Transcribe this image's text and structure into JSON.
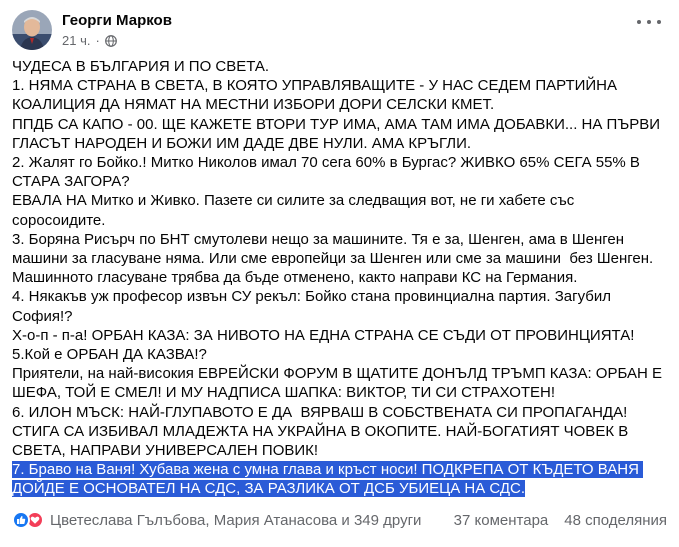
{
  "post": {
    "author": "Георги Марков",
    "time": "21 ч.",
    "dot": "·",
    "paragraphs": [
      "ЧУДЕСА В БЪЛГАРИЯ И ПО СВЕТА.",
      "1. НЯМА СТРАНА В СВЕТА, В КОЯТО УПРАВЛЯВАЩИТЕ - У НАС СЕДЕМ ПАРТИЙНА КОАЛИЦИЯ ДА НЯМАТ НА МЕСТНИ ИЗБОРИ ДОРИ СЕЛСКИ КМЕТ.",
      "ППДБ СА КАПО - 00. ЩЕ КАЖЕТЕ ВТОРИ ТУР ИМА, АМА ТАМ ИМА ДОБАВКИ... НА ПЪРВИ ГЛАСЪТ НАРОДЕН И БОЖИ ИМ ДАДЕ ДВЕ НУЛИ. АМА КРЪГЛИ.",
      "2. Жалят го Бойко.! Митко Николов имал 70 сега 60% в Бургас? ЖИВКО 65% СЕГА 55% В СТАРА ЗАГОРА?",
      "ЕВАЛА НА Митко и Живко. Пазете си силите за следващия вот, не ги хабете със соросоидите.",
      "3. Боряна Рисърч по БНТ смутолеви нещо за машините. Тя е за, Шенген, ама в Шенген машини за гласуване няма. Или сме европейци за Шенген или сме за машини  без Шенген. Машинното гласуване трябва да бъде отменено, както направи КС на Германия.",
      "4. Някакъв уж професор извън СУ рекъл: Бойко стана провинциална партия. Загубил София!?",
      "Х-о-п - п-а! ОРБАН КАЗА: ЗА НИВОТО НА ЕДНА СТРАНА СЕ СЪДИ ОТ ПРОВИНЦИЯТА!",
      "5.Кой е ОРБАН ДА КАЗВА!?",
      "Приятели, на най-високия ЕВРЕЙСКИ ФОРУМ В ЩАТИТЕ ДОНЪЛД ТРЪМП КАЗА: ОРБАН Е ШЕФА, ТОЙ Е СМЕЛ! И МУ НАДПИСА ШАПКА: ВИКТОР, ТИ СИ СТРАХОТЕН!",
      "6. ИЛОН МЪСК: НАЙ-ГЛУПАВОТО Е ДА  ВЯРВАШ В СОБСТВЕНАТА СИ ПРОПАГАНДА! СТИГА СА ИЗБИВАЛ МЛАДЕЖТА НА УКРАЙНА В ОКОПИТЕ. НАЙ-БОГАТИЯТ ЧОВЕК В СВЕТА, НАПРАВИ УНИВЕРСАЛЕН ПОВИК!"
    ],
    "highlighted_paragraph": "7. Браво на Ваня! Хубава жена с умна глава и кръст носи! ПОДКРЕПА ОТ КЪДЕТО ВАНЯ ДОЙДЕ Е ОСНОВАТЕЛ НА СДС, ЗА РАЗЛИКА ОТ ДСБ УБИЕЦА НА СДС."
  },
  "footer": {
    "reactions_text": "Цветеслава Гълъбова, Мария Атанасова и 349 други",
    "comments": "37 коментара",
    "shares": "48 споделяния"
  },
  "icons": {
    "avatar": "profile-photo",
    "privacy": "globe-icon",
    "menu": "more-horizontal-icon",
    "reaction_1": "like-icon",
    "reaction_2": "love-icon"
  },
  "colors": {
    "selection": "#2a5bd7",
    "like": "#1877f2",
    "love": "#f33e58",
    "secondary_text": "#65676b"
  }
}
